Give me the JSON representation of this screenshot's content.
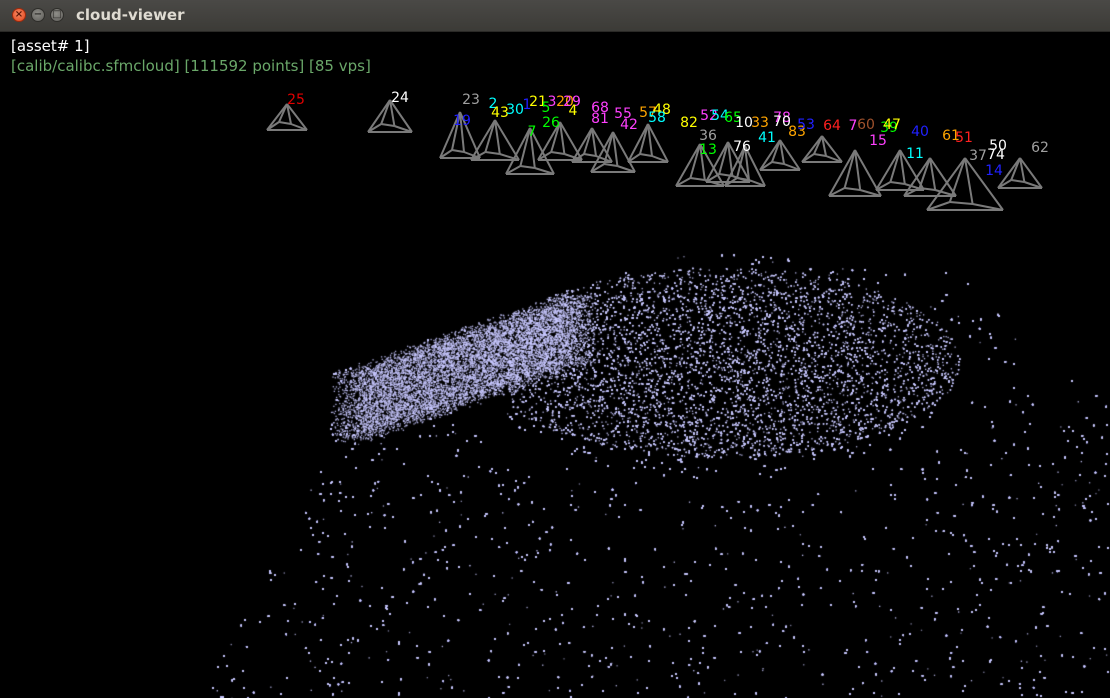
{
  "window": {
    "title": "cloud-viewer",
    "buttons": {
      "close": "×",
      "minimize": "−",
      "maximize": "□"
    }
  },
  "hud": {
    "asset": "[asset# 1]",
    "info": "[calib/calibc.sfmcloud] [111592 points] [85 vps]"
  },
  "colors": {
    "background": "#000000",
    "points": "#c8c8ff",
    "camera_frustum": "#7a7a7a",
    "hud_info": "#6aa769"
  },
  "cameras": [
    {
      "label": "25",
      "color": "#e00000"
    },
    {
      "label": "24",
      "color": "#ffffff"
    },
    {
      "label": "23",
      "color": "#a0a0a0"
    },
    {
      "label": "19",
      "color": "#2020ff"
    },
    {
      "label": "2",
      "color": "#00ffff"
    },
    {
      "label": "43",
      "color": "#ffff00"
    },
    {
      "label": "30",
      "color": "#00ffff"
    },
    {
      "label": "1",
      "color": "#2020ff"
    },
    {
      "label": "21",
      "color": "#ffff00"
    },
    {
      "label": "3",
      "color": "#ff40ff"
    },
    {
      "label": "20",
      "color": "#ffa500"
    },
    {
      "label": "29",
      "color": "#ff40ff"
    },
    {
      "label": "5",
      "color": "#00ff00"
    },
    {
      "label": "4",
      "color": "#ffff00"
    },
    {
      "label": "26",
      "color": "#00ff00"
    },
    {
      "label": "7",
      "color": "#00ff00"
    },
    {
      "label": "68",
      "color": "#ff40ff"
    },
    {
      "label": "81",
      "color": "#ff40ff"
    },
    {
      "label": "55",
      "color": "#ff40ff"
    },
    {
      "label": "42",
      "color": "#ff40ff"
    },
    {
      "label": "57",
      "color": "#ffa500"
    },
    {
      "label": "48",
      "color": "#ffff00"
    },
    {
      "label": "58",
      "color": "#00ffff"
    },
    {
      "label": "82",
      "color": "#ffff00"
    },
    {
      "label": "52",
      "color": "#ff40ff"
    },
    {
      "label": "54",
      "color": "#00ffff"
    },
    {
      "label": "65",
      "color": "#00ff00"
    },
    {
      "label": "36",
      "color": "#a0a0a0"
    },
    {
      "label": "13",
      "color": "#00ff00"
    },
    {
      "label": "76",
      "color": "#ffffff"
    },
    {
      "label": "10",
      "color": "#ffffff"
    },
    {
      "label": "33",
      "color": "#ffa500"
    },
    {
      "label": "41",
      "color": "#00ffff"
    },
    {
      "label": "78",
      "color": "#ff40ff"
    },
    {
      "label": "70",
      "color": "#ffffff"
    },
    {
      "label": "83",
      "color": "#ffa500"
    },
    {
      "label": "53",
      "color": "#2020ff"
    },
    {
      "label": "64",
      "color": "#ff2020"
    },
    {
      "label": "7",
      "color": "#ff40ff"
    },
    {
      "label": "60",
      "color": "#a0522d"
    },
    {
      "label": "15",
      "color": "#ff40ff"
    },
    {
      "label": "39",
      "color": "#00ff00"
    },
    {
      "label": "47",
      "color": "#ffff00"
    },
    {
      "label": "11",
      "color": "#00ffff"
    },
    {
      "label": "40",
      "color": "#2020ff"
    },
    {
      "label": "61",
      "color": "#ffa500"
    },
    {
      "label": "51",
      "color": "#ff2020"
    },
    {
      "label": "37",
      "color": "#a0a0a0"
    },
    {
      "label": "50",
      "color": "#ffffff"
    },
    {
      "label": "74",
      "color": "#ffffff"
    },
    {
      "label": "14",
      "color": "#2020ff"
    },
    {
      "label": "62",
      "color": "#a0a0a0"
    }
  ]
}
